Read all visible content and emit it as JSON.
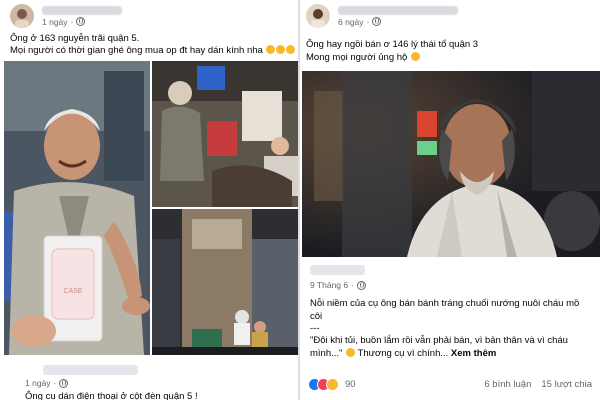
{
  "left_post": {
    "time": "1 ngày",
    "text_line1": "Ông ở 163 nguyễn trãi quận 5.",
    "text_line2": "Mọi người có thời gian ghé ông mua op đt hay dán kính nha",
    "bag_label": "CASE"
  },
  "left_comment": {
    "time": "1 ngày",
    "text": "Ông cụ dán điện thoại ở cột đèn quận 5 !"
  },
  "right_post": {
    "time": "6 ngày",
    "text_line1": "Ông hay ngồi bán ơ 146 lý thái tổ quận 3",
    "text_line2": "Mong mọi người ủng hộ"
  },
  "right_shared": {
    "time": "9 Tháng 6",
    "text_line1": "Nỗi niềm của cụ ông bán bánh tráng chuối nướng nuôi cháu mồ",
    "text_line2": "côi",
    "separator": "---",
    "quote_line1": "\"Đôi khi tủi, buồn lắm rồi vẫn phải bán, vì bản thân và vì cháu",
    "quote_line2": "mình...\"",
    "quote_line2_rest": " Thương cụ vì chính...",
    "see_more": "Xem thêm"
  },
  "right_stats": {
    "reaction_count": "90",
    "comments": "6 bình luận",
    "shares": "15 lượt chia"
  },
  "colors": {
    "accent": "#1877f2",
    "secondary_text": "#65676b",
    "like": "#1877f2",
    "love": "#f33e58",
    "sad": "#f7b928"
  }
}
